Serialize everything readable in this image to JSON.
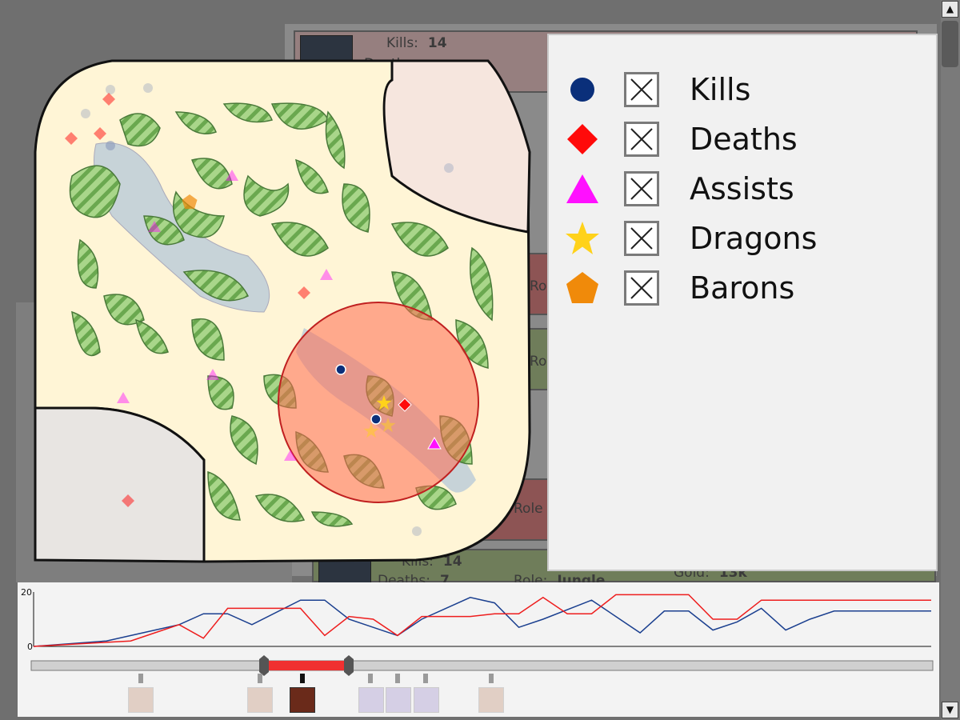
{
  "legend": {
    "items": [
      {
        "label": "Kills",
        "icon": "circle-icon",
        "color": "#0a2f7a",
        "checked": true
      },
      {
        "label": "Deaths",
        "icon": "diamond-icon",
        "color": "#ff0a0a",
        "checked": true
      },
      {
        "label": "Assists",
        "icon": "triangle-icon",
        "color": "#ff10ff",
        "checked": true
      },
      {
        "label": "Dragons",
        "icon": "star-icon",
        "color": "#ffd21a",
        "checked": true
      },
      {
        "label": "Barons",
        "icon": "pentagon-icon",
        "color": "#f08a0a",
        "checked": true
      }
    ]
  },
  "cards": [
    {
      "kills_label": "Kills:",
      "kills_value": "14",
      "deaths_label": "Death",
      "deaths_value": ""
    },
    {
      "kills_label": "Kills:",
      "kills_value": "14",
      "deaths_label": "Deaths:",
      "deaths_value": "7",
      "role_label": "Role:",
      "role_value": "Jungle",
      "gold_label": "Gold:",
      "gold_value": "13k"
    }
  ],
  "card_partial_labels": [
    "Role",
    "Role",
    "Role"
  ],
  "timeline": {
    "y_max_label": "20",
    "y_min_label": "0",
    "series_colors": {
      "blue": "#1a3f8f",
      "red": "#ee1d1d"
    },
    "range_color": "#f03030"
  },
  "chart_data": {
    "type": "line",
    "ylim": [
      0,
      20
    ],
    "xlim": [
      0,
      37
    ],
    "series": [
      {
        "x": [
          0,
          3,
          5,
          6,
          7,
          8,
          9,
          11,
          12,
          13,
          14,
          15,
          16,
          18,
          19,
          20,
          21,
          23,
          24,
          25,
          26,
          27,
          28,
          29,
          30,
          31,
          32,
          33,
          34,
          35,
          37
        ],
        "values": [
          0,
          2,
          6,
          8,
          12,
          12,
          8,
          17,
          17,
          10,
          7,
          4,
          10,
          18,
          16,
          7,
          10,
          17,
          11,
          5,
          13,
          13,
          6,
          9,
          14,
          6,
          10,
          13,
          13,
          13,
          13
        ]
      },
      {
        "x": [
          0,
          3,
          4,
          5,
          6,
          7,
          8,
          9,
          11,
          12,
          13,
          14,
          15,
          16,
          18,
          19,
          20,
          21,
          22,
          23,
          24,
          25,
          26,
          27,
          28,
          29,
          30,
          31,
          32,
          33,
          34,
          35,
          37
        ],
        "values": [
          0,
          1.5,
          2,
          5,
          8,
          3,
          14,
          14,
          14,
          4,
          11,
          10,
          4,
          11,
          11,
          12,
          12,
          18,
          12,
          12,
          19,
          19,
          19,
          19,
          10,
          10,
          17,
          17,
          17,
          17,
          17,
          17,
          17
        ]
      }
    ]
  },
  "scrollbar": {
    "up": "▲",
    "down": "▼"
  }
}
